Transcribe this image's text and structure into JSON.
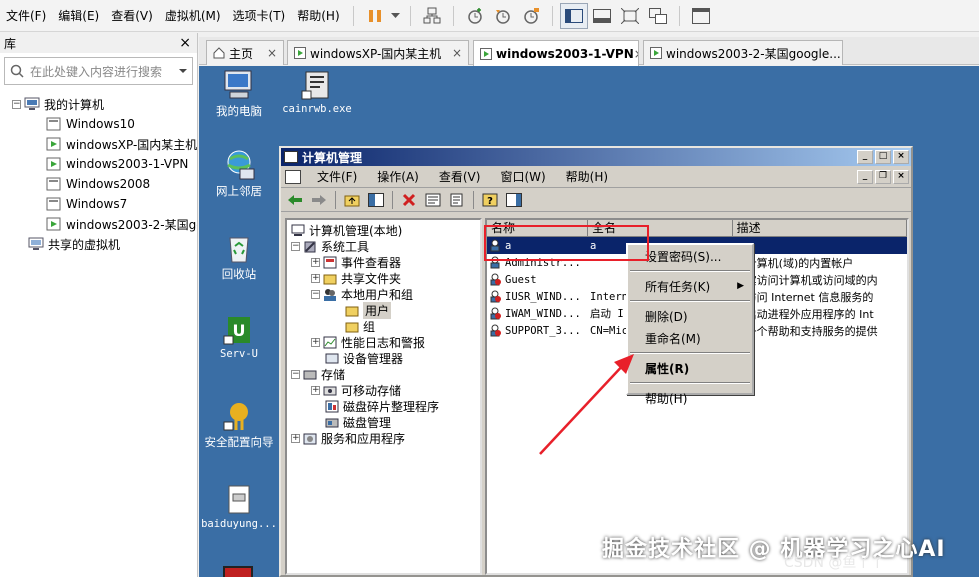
{
  "menubar": {
    "items": [
      "文件(F)",
      "编辑(E)",
      "查看(V)",
      "虚拟机(M)",
      "选项卡(T)",
      "帮助(H)"
    ]
  },
  "library": {
    "title": "库",
    "close": "×",
    "search_placeholder": "在此处键入内容进行搜索",
    "tree": {
      "root": "我的计算机",
      "vms": [
        "Windows10",
        "windowsXP-国内某主机",
        "windows2003-1-VPN",
        "Windows2008",
        "Windows7",
        "windows2003-2-某国google"
      ],
      "shared": "共享的虚拟机"
    }
  },
  "tabs": {
    "home": "主页",
    "items": [
      "windowsXP-国内某主机",
      "windows2003-1-VPN",
      "windows2003-2-某国google..."
    ],
    "close": "×"
  },
  "desktop": {
    "icons": [
      "我的电脑",
      "cainrwb.exe",
      "网上邻居",
      "回收站",
      "Serv-U",
      "安全配置向导",
      "baiduyung..."
    ]
  },
  "cm_window": {
    "title": "计算机管理",
    "menu": [
      "文件(F)",
      "操作(A)",
      "查看(V)",
      "窗口(W)",
      "帮助(H)"
    ],
    "tree": {
      "root": "计算机管理(本地)",
      "system_tools": "系统工具",
      "event_viewer": "事件查看器",
      "shared_folders": "共享文件夹",
      "local_users": "本地用户和组",
      "users": "用户",
      "groups": "组",
      "perf_logs": "性能日志和警报",
      "device_mgr": "设备管理器",
      "storage": "存储",
      "removable": "可移动存储",
      "defrag": "磁盘碎片整理程序",
      "disk_mgmt": "磁盘管理",
      "services_apps": "服务和应用程序"
    },
    "columns": [
      "名称",
      "全名",
      "描述"
    ],
    "rows": [
      {
        "name": "a",
        "fullname": "a",
        "desc": ""
      },
      {
        "name": "Administr...",
        "fullname": "",
        "desc": "理计算机(域)的内置帐户"
      },
      {
        "name": "Guest",
        "fullname": "",
        "desc": "来宾访问计算机或访问域的内"
      },
      {
        "name": "IUSR_WIND...",
        "fullname": "Intern",
        "desc": "名访问 Internet 信息服务的"
      },
      {
        "name": "IWAM_WIND...",
        "fullname": "启动 I",
        "desc": "于启动进程外应用程序的 Int"
      },
      {
        "name": "SUPPORT_3...",
        "fullname": "CN=Mic",
        "desc": "是一个帮助和支持服务的提供"
      }
    ]
  },
  "context_menu": {
    "set_password": "设置密码(S)...",
    "all_tasks": "所有任务(K)",
    "delete": "删除(D)",
    "rename": "重命名(M)",
    "properties": "属性(R)",
    "help": "帮助(H)"
  },
  "watermark": "掘金技术社区 @ 机器学习之心AI",
  "watermark2": "CSDN @鱼丫丫"
}
